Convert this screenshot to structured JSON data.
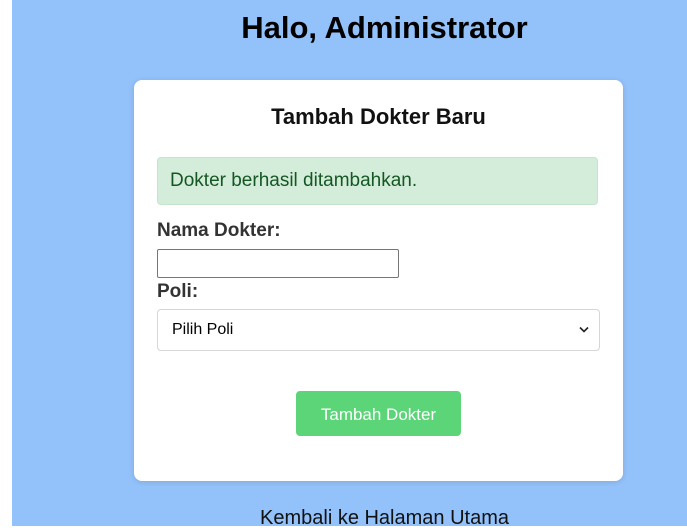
{
  "header": {
    "greeting": "Halo, Administrator"
  },
  "form": {
    "title": "Tambah Dokter Baru",
    "success_message": "Dokter berhasil ditambahkan.",
    "nama_label": "Nama Dokter:",
    "nama_value": "",
    "poli_label": "Poli:",
    "poli_selected": "Pilih Poli",
    "submit_label": "Tambah Dokter"
  },
  "footer": {
    "back_link": "Kembali ke Halaman Utama"
  },
  "colors": {
    "page_background": "#93c1f9",
    "success_background": "#d4edda",
    "success_text": "#155724",
    "submit_button": "#5cd478"
  },
  "icons": {
    "select_arrow": "chevron-down-icon"
  }
}
